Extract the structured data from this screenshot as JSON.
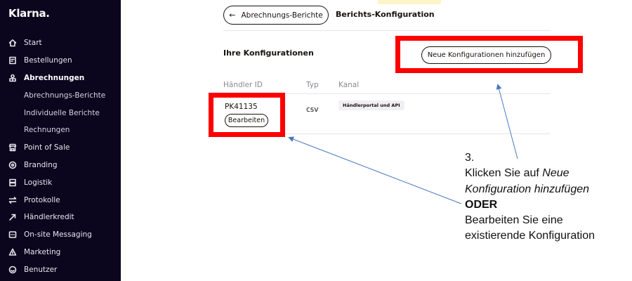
{
  "sidebar": {
    "logo": "Klarna.",
    "items": [
      {
        "label": "Start",
        "icon": "home-icon",
        "type": "main"
      },
      {
        "label": "Bestellungen",
        "icon": "orders-icon",
        "type": "main"
      },
      {
        "label": "Abrechnungen",
        "icon": "settlements-icon",
        "type": "main",
        "active": true
      },
      {
        "label": "Abrechnungs-Berichte",
        "type": "sub"
      },
      {
        "label": "Individuelle Berichte",
        "type": "sub"
      },
      {
        "label": "Rechnungen",
        "type": "sub"
      },
      {
        "label": "Point of Sale",
        "icon": "store-icon",
        "type": "main"
      },
      {
        "label": "Branding",
        "icon": "branding-icon",
        "type": "main"
      },
      {
        "label": "Logistik",
        "icon": "logistics-icon",
        "type": "main"
      },
      {
        "label": "Protokolle",
        "icon": "logs-icon",
        "type": "main"
      },
      {
        "label": "Händlerkredit",
        "icon": "credit-icon",
        "type": "main"
      },
      {
        "label": "On-site Messaging",
        "icon": "messaging-icon",
        "type": "main"
      },
      {
        "label": "Marketing",
        "icon": "marketing-icon",
        "type": "main"
      },
      {
        "label": "Benutzer",
        "icon": "users-icon",
        "type": "main"
      }
    ]
  },
  "header": {
    "back_label": "Abrechnungs-Berichte",
    "title": "Berichts-Konfiguration"
  },
  "configs": {
    "section_title": "Ihre Konfigurationen",
    "add_button_label": "Neue Konfigurationen hinzufügen",
    "columns": [
      "Händler ID",
      "Typ",
      "Kanal"
    ],
    "rows": [
      {
        "merchant_id": "PK41135",
        "type": "csv",
        "channel": "Händlerportal und API",
        "edit_label": "Bearbeiten"
      }
    ]
  },
  "annotation": {
    "color": "#ff0000",
    "step": "3.",
    "line1": "Klicken Sie auf ",
    "line1_em": "Neue",
    "line2_em": "Konfiguration hinzufügen",
    "or_label": "ODER",
    "line3": "Bearbeiten Sie eine",
    "line4": "existierende Konfiguration"
  }
}
